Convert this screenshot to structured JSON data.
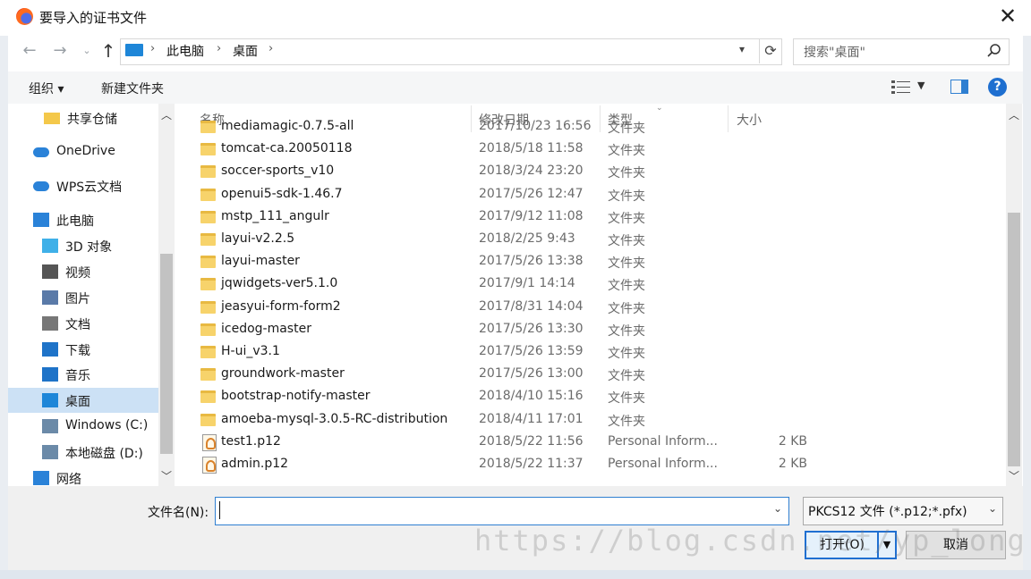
{
  "window": {
    "title": "要导入的证书文件"
  },
  "address": {
    "breadcrumbs": [
      "此电脑",
      "桌面"
    ],
    "search_placeholder": "搜索\"桌面\""
  },
  "toolbar": {
    "organize": "组织 ▾",
    "new_folder": "新建文件夹"
  },
  "nav": {
    "items": [
      {
        "label": "共享仓储",
        "icon": "folder-icon"
      },
      {
        "label": "OneDrive",
        "icon": "cloud-icon"
      },
      {
        "label": "WPS云文档",
        "icon": "cloud-icon"
      },
      {
        "label": "此电脑",
        "icon": "computer-icon"
      },
      {
        "label": "3D 对象",
        "icon": "cube-icon"
      },
      {
        "label": "视频",
        "icon": "video-icon"
      },
      {
        "label": "图片",
        "icon": "picture-icon"
      },
      {
        "label": "文档",
        "icon": "document-icon"
      },
      {
        "label": "下载",
        "icon": "download-icon"
      },
      {
        "label": "音乐",
        "icon": "music-icon"
      },
      {
        "label": "桌面",
        "icon": "desktop-icon"
      },
      {
        "label": "Windows (C:)",
        "icon": "drive-icon"
      },
      {
        "label": "本地磁盘 (D:)",
        "icon": "drive-icon"
      },
      {
        "label": "网络",
        "icon": "network-icon"
      }
    ],
    "selected_index": 10
  },
  "columns": {
    "name": "名称",
    "date": "修改日期",
    "type": "类型",
    "size": "大小"
  },
  "files": [
    {
      "name": "mediamagic-0.7.5-all",
      "date": "2017/10/23 16:56",
      "type": "文件夹",
      "size": "",
      "kind": "folder"
    },
    {
      "name": "tomcat-ca.20050118",
      "date": "2018/5/18 11:58",
      "type": "文件夹",
      "size": "",
      "kind": "folder"
    },
    {
      "name": "soccer-sports_v10",
      "date": "2018/3/24 23:20",
      "type": "文件夹",
      "size": "",
      "kind": "folder"
    },
    {
      "name": "openui5-sdk-1.46.7",
      "date": "2017/5/26 12:47",
      "type": "文件夹",
      "size": "",
      "kind": "folder"
    },
    {
      "name": "mstp_111_angulr",
      "date": "2017/9/12 11:08",
      "type": "文件夹",
      "size": "",
      "kind": "folder"
    },
    {
      "name": "layui-v2.2.5",
      "date": "2018/2/25 9:43",
      "type": "文件夹",
      "size": "",
      "kind": "folder"
    },
    {
      "name": "layui-master",
      "date": "2017/5/26 13:38",
      "type": "文件夹",
      "size": "",
      "kind": "folder"
    },
    {
      "name": "jqwidgets-ver5.1.0",
      "date": "2017/9/1 14:14",
      "type": "文件夹",
      "size": "",
      "kind": "folder"
    },
    {
      "name": "jeasyui-form-form2",
      "date": "2017/8/31 14:04",
      "type": "文件夹",
      "size": "",
      "kind": "folder"
    },
    {
      "name": "icedog-master",
      "date": "2017/5/26 13:30",
      "type": "文件夹",
      "size": "",
      "kind": "folder"
    },
    {
      "name": "H-ui_v3.1",
      "date": "2017/5/26 13:59",
      "type": "文件夹",
      "size": "",
      "kind": "folder"
    },
    {
      "name": "groundwork-master",
      "date": "2017/5/26 13:00",
      "type": "文件夹",
      "size": "",
      "kind": "folder"
    },
    {
      "name": "bootstrap-notify-master",
      "date": "2018/4/10 15:16",
      "type": "文件夹",
      "size": "",
      "kind": "folder"
    },
    {
      "name": "amoeba-mysql-3.0.5-RC-distribution",
      "date": "2018/4/11 17:01",
      "type": "文件夹",
      "size": "",
      "kind": "folder"
    },
    {
      "name": "test1.p12",
      "date": "2018/5/22 11:56",
      "type": "Personal Inform...",
      "size": "2 KB",
      "kind": "pfx"
    },
    {
      "name": "admin.p12",
      "date": "2018/5/22 11:37",
      "type": "Personal Inform...",
      "size": "2 KB",
      "kind": "pfx"
    }
  ],
  "footer": {
    "filename_label": "文件名(N):",
    "filename_value": "",
    "filter": "PKCS12 文件 (*.p12;*.pfx)",
    "open_label": "打开(O)",
    "cancel_label": "取消"
  },
  "watermark": "https://blog.csdn.net/yp_long"
}
